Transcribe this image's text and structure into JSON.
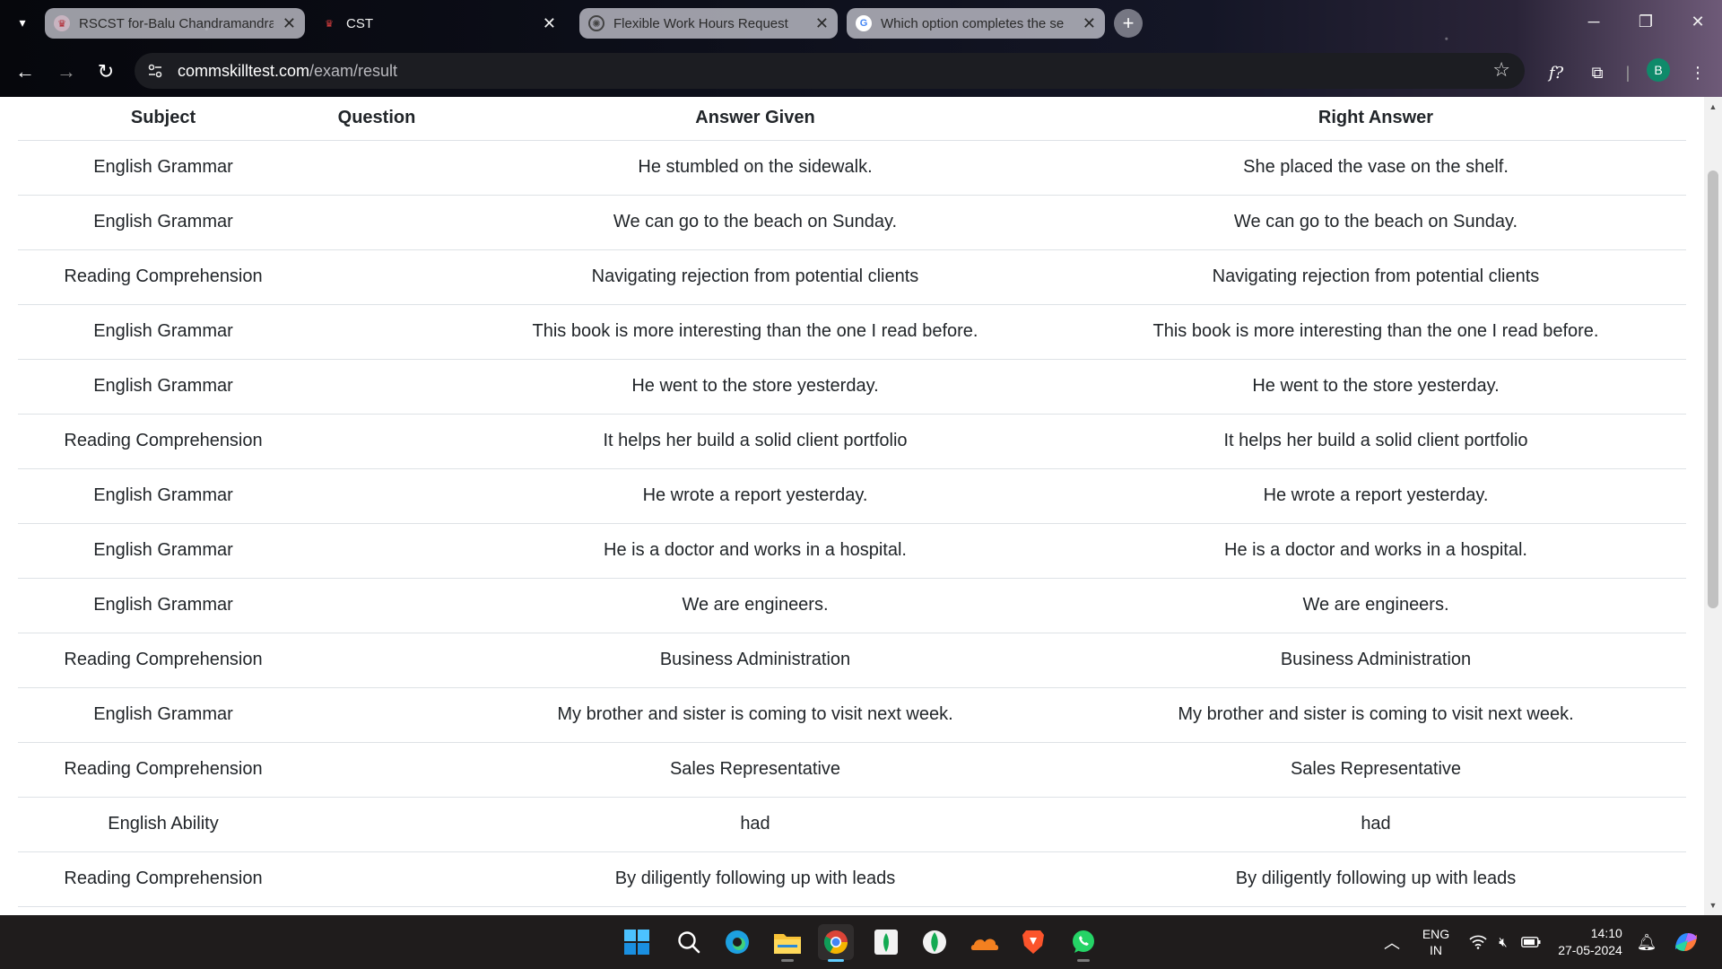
{
  "browser": {
    "tabs": [
      {
        "title": "RSCST for-Balu Chandramandra",
        "favicon": "cst-logo-icon",
        "style": "light"
      },
      {
        "title": "CST",
        "favicon": "cst-logo-icon",
        "style": "dark"
      },
      {
        "title": "Flexible Work Hours Request",
        "favicon": "chatgpt-icon",
        "style": "light"
      },
      {
        "title": "Which option completes the se",
        "favicon": "google-icon",
        "style": "light"
      }
    ],
    "new_tab_label": "+",
    "url_host": "commskilltest.com",
    "url_path": "/exam/result",
    "profile_initial": "B"
  },
  "table": {
    "headers": {
      "subject": "Subject",
      "question": "Question",
      "answer_given": "Answer Given",
      "right_answer": "Right Answer"
    },
    "rows": [
      {
        "subject": "English Grammar",
        "question": "",
        "answer_given": "He stumbled on the sidewalk.",
        "right_answer": "She placed the vase on the shelf."
      },
      {
        "subject": "English Grammar",
        "question": "",
        "answer_given": "We can go to the beach on Sunday.",
        "right_answer": "We can go to the beach on Sunday."
      },
      {
        "subject": "Reading Comprehension",
        "question": "",
        "answer_given": "Navigating rejection from potential clients",
        "right_answer": "Navigating rejection from potential clients"
      },
      {
        "subject": "English Grammar",
        "question": "",
        "answer_given": "This book is more interesting than the one I read before.",
        "right_answer": "This book is more interesting than the one I read before."
      },
      {
        "subject": "English Grammar",
        "question": "",
        "answer_given": "He went to the store yesterday.",
        "right_answer": "He went to the store yesterday."
      },
      {
        "subject": "Reading Comprehension",
        "question": "",
        "answer_given": "It helps her build a solid client portfolio",
        "right_answer": "It helps her build a solid client portfolio"
      },
      {
        "subject": "English Grammar",
        "question": "",
        "answer_given": "He wrote a report yesterday.",
        "right_answer": "He wrote a report yesterday."
      },
      {
        "subject": "English Grammar",
        "question": "",
        "answer_given": "He is a doctor and works in a hospital.",
        "right_answer": "He is a doctor and works in a hospital."
      },
      {
        "subject": "English Grammar",
        "question": "",
        "answer_given": "We are engineers.",
        "right_answer": "We are engineers."
      },
      {
        "subject": "Reading Comprehension",
        "question": "",
        "answer_given": "Business Administration",
        "right_answer": "Business Administration"
      },
      {
        "subject": "English Grammar",
        "question": "",
        "answer_given": "My brother and sister is coming to visit next week.",
        "right_answer": "My brother and sister is coming to visit next week."
      },
      {
        "subject": "Reading Comprehension",
        "question": "",
        "answer_given": "Sales Representative",
        "right_answer": "Sales Representative"
      },
      {
        "subject": "English Ability",
        "question": "",
        "answer_given": "had",
        "right_answer": "had"
      },
      {
        "subject": "Reading Comprehension",
        "question": "",
        "answer_given": "By diligently following up with leads",
        "right_answer": "By diligently following up with leads"
      }
    ]
  },
  "taskbar": {
    "apps": [
      "windows-start-icon",
      "search-icon",
      "edge-icon",
      "file-explorer-icon",
      "chrome-icon",
      "mongodb-compass-icon",
      "mongodb-icon",
      "cloudflare-icon",
      "brave-icon",
      "whatsapp-icon"
    ],
    "language_line1": "ENG",
    "language_line2": "IN",
    "time": "14:10",
    "date": "27-05-2024"
  },
  "colors": {
    "text": "#212529",
    "row_border": "#dee2e6",
    "taskbar": "#1f1c1c",
    "omnibox": "#1c1d22",
    "avatar": "#0f8a6a"
  }
}
